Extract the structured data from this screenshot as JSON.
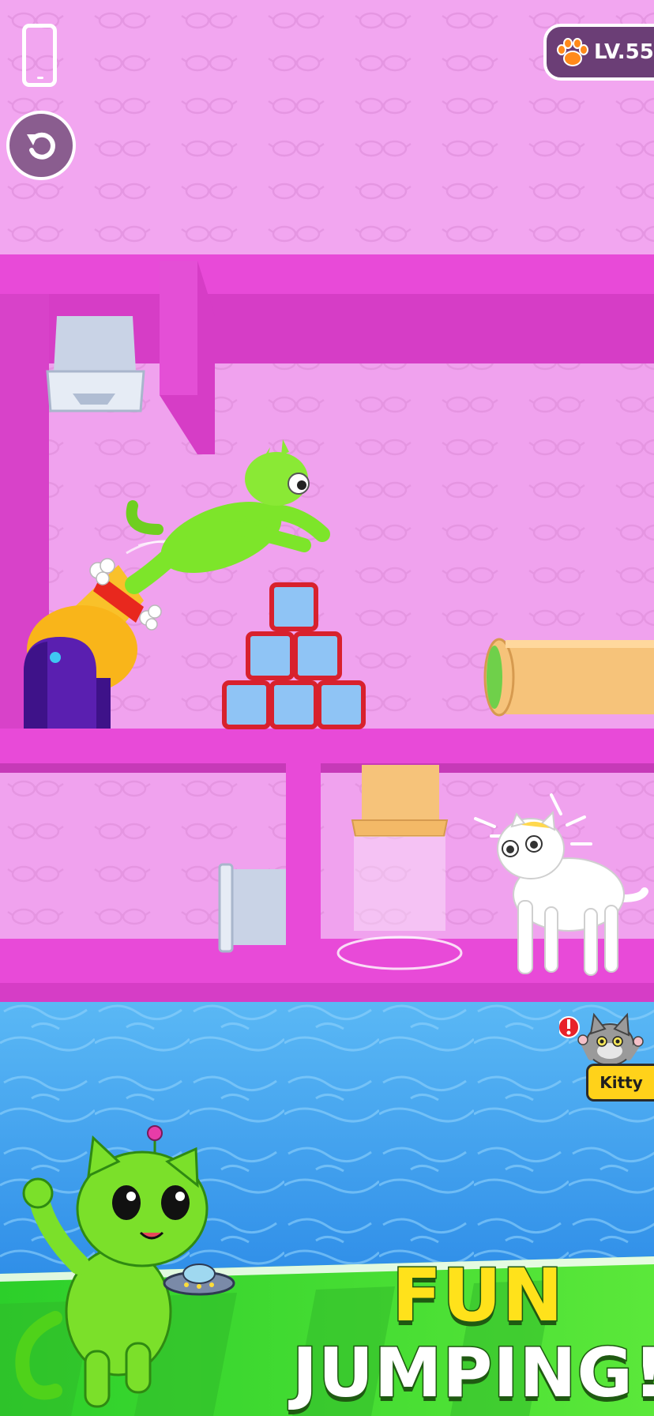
{
  "hud": {
    "device_icon": "phone-outline-icon",
    "reset_icon": "restart-arrow-icon",
    "level_icon": "paw-icon",
    "level_text": "LV.55"
  },
  "hint": {
    "label": "Kitty",
    "alert_icon": "exclamation-icon"
  },
  "promo": {
    "line1": "FUN",
    "line2": "JUMPING!"
  },
  "colors": {
    "wall_pink": "#f2a6f0",
    "floor_magenta": "#e84ad8",
    "water_blue": "#4aa8f0",
    "grass_green": "#3ddc2a",
    "cat_green": "#7de52a",
    "box_red": "#e8323c",
    "box_blue": "#8fc4f5"
  }
}
